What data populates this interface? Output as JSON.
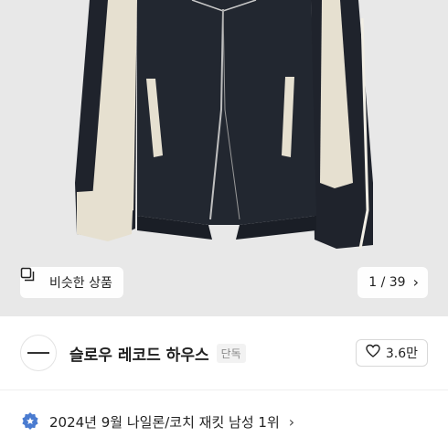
{
  "gallery": {
    "similar_label": "비슷한 상품",
    "similar_icon": "similar-items-icon",
    "pager_current": "1",
    "pager_separator": "/",
    "pager_total": "39",
    "pager_next_icon": "chevron-right-icon"
  },
  "store": {
    "name": "슬로우 레코드 하우스",
    "badge": "단독",
    "likes": "3.6만",
    "like_icon": "heart-icon"
  },
  "ranking": {
    "text": "2024년 9월 나일론/코치 재킷 남성 1위",
    "icon": "ranking-badge-icon",
    "badge_color": "#4a7bd0"
  },
  "colors": {
    "jacket_body": "#1f232c",
    "jacket_panel": "#e6e0d0",
    "background": "#e8e8e8"
  }
}
